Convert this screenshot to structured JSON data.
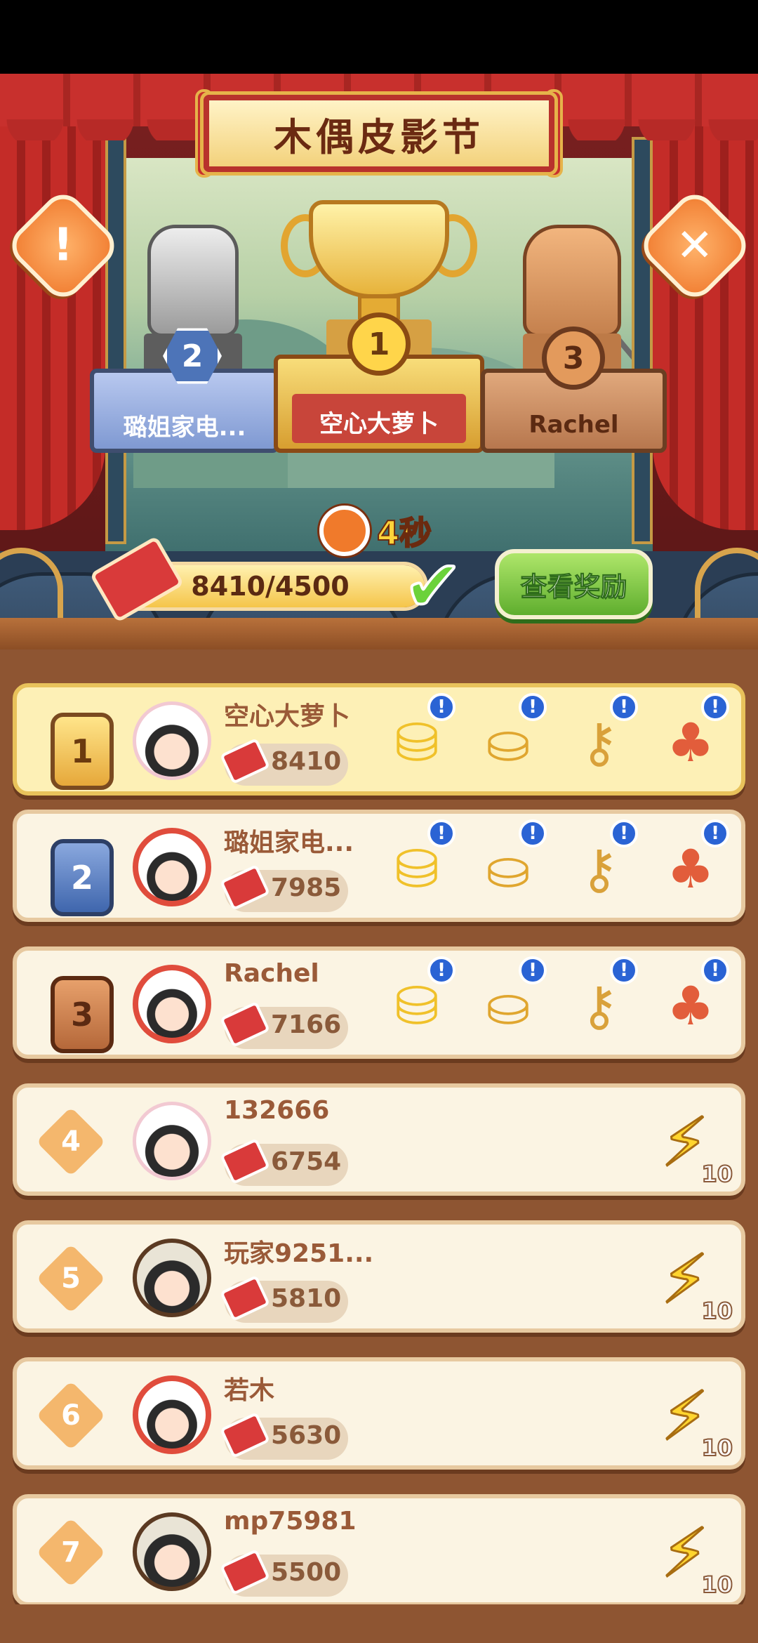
{
  "stage": {
    "title": "木偶皮影节",
    "info_icon": "exclamation-icon",
    "close_icon": "close-icon",
    "podium": [
      {
        "rank": "2",
        "name": "璐姐家电..."
      },
      {
        "rank": "1",
        "name": "空心大萝卜"
      },
      {
        "rank": "3",
        "name": "Rachel"
      }
    ],
    "timer": "4秒",
    "progress": {
      "text": "8410/4500",
      "fraction": 1.0
    },
    "reward_button": "查看奖励",
    "check_glyph": "✔"
  },
  "leaderboard": [
    {
      "rank": "1",
      "name": "空心大萝卜",
      "score": "8410"
    },
    {
      "rank": "2",
      "name": "璐姐家电...",
      "score": "7985"
    },
    {
      "rank": "3",
      "name": "Rachel",
      "score": "7166"
    },
    {
      "rank": "4",
      "name": "132666",
      "score": "6754",
      "reward": "10"
    },
    {
      "rank": "5",
      "name": "玩家9251...",
      "score": "5810",
      "reward": "10"
    },
    {
      "rank": "6",
      "name": "若木",
      "score": "5630",
      "reward": "10"
    },
    {
      "rank": "7",
      "name": "mp75981",
      "score": "5500",
      "reward": "10"
    }
  ],
  "reward_icons": [
    "gold-bucket-icon",
    "treasure-chest-icon",
    "key-icon",
    "lucky-bag-icon"
  ],
  "colors": {
    "accent": "#f5c54a",
    "panel": "#fbf4e3",
    "list_bg": "#8e5532",
    "button_green": "#5fae2e"
  }
}
